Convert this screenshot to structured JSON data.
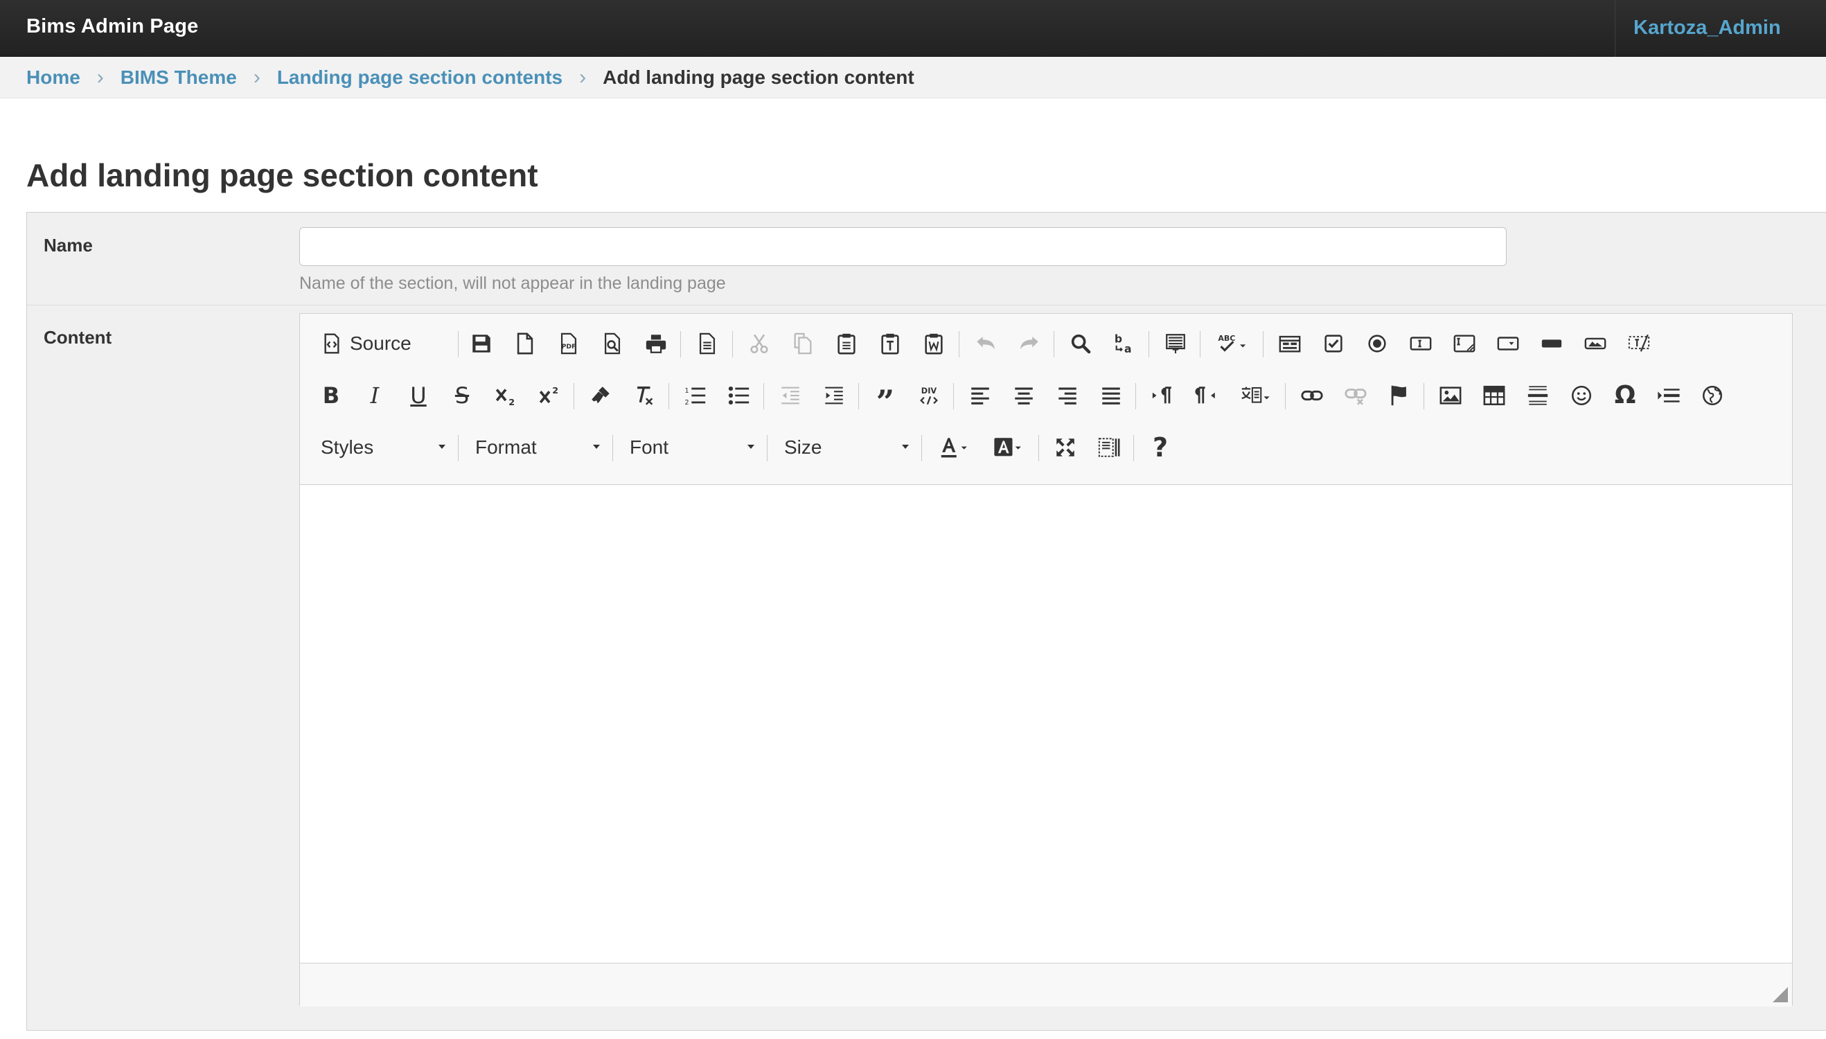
{
  "header": {
    "title": "Bims Admin Page",
    "user": "Kartoza_Admin"
  },
  "breadcrumbs": {
    "items": [
      "Home",
      "BIMS Theme",
      "Landing page section contents"
    ],
    "current": "Add landing page section content"
  },
  "page": {
    "title": "Add landing page section content"
  },
  "form": {
    "name_label": "Name",
    "name_value": "",
    "name_help": "Name of the section, will not appear in the landing page",
    "content_label": "Content"
  },
  "editor": {
    "source_label": "Source",
    "combos": {
      "styles": "Styles",
      "format": "Format",
      "font": "Font",
      "size": "Size"
    },
    "toolbar_icons": [
      "source-icon",
      "save-icon",
      "new-page-icon",
      "export-pdf-icon",
      "preview-icon",
      "print-icon",
      "templates-icon",
      "cut-icon",
      "copy-icon",
      "paste-icon",
      "paste-text-icon",
      "paste-word-icon",
      "undo-icon",
      "redo-icon",
      "find-icon",
      "replace-icon",
      "select-all-icon",
      "spellcheck-icon",
      "form-icon",
      "checkbox-icon",
      "radio-icon",
      "text-field-icon",
      "textarea-icon",
      "select-field-icon",
      "button-icon",
      "image-button-icon",
      "hidden-field-icon",
      "bold-icon",
      "italic-icon",
      "underline-icon",
      "strike-icon",
      "subscript-icon",
      "superscript-icon",
      "copy-formatting-icon",
      "remove-format-icon",
      "numbered-list-icon",
      "bulleted-list-icon",
      "outdent-icon",
      "indent-icon",
      "blockquote-icon",
      "div-container-icon",
      "align-left-icon",
      "align-center-icon",
      "align-right-icon",
      "justify-icon",
      "ltr-icon",
      "rtl-icon",
      "language-icon",
      "link-icon",
      "unlink-icon",
      "anchor-icon",
      "image-icon",
      "table-icon",
      "horizontal-line-icon",
      "smiley-icon",
      "special-char-icon",
      "page-break-icon",
      "iframe-icon",
      "text-color-icon",
      "bg-color-icon",
      "maximize-icon",
      "show-blocks-icon",
      "about-icon"
    ],
    "colors": {
      "link": "#4a90b8",
      "user": "#56a6cf",
      "header_bg": "#222222"
    }
  }
}
